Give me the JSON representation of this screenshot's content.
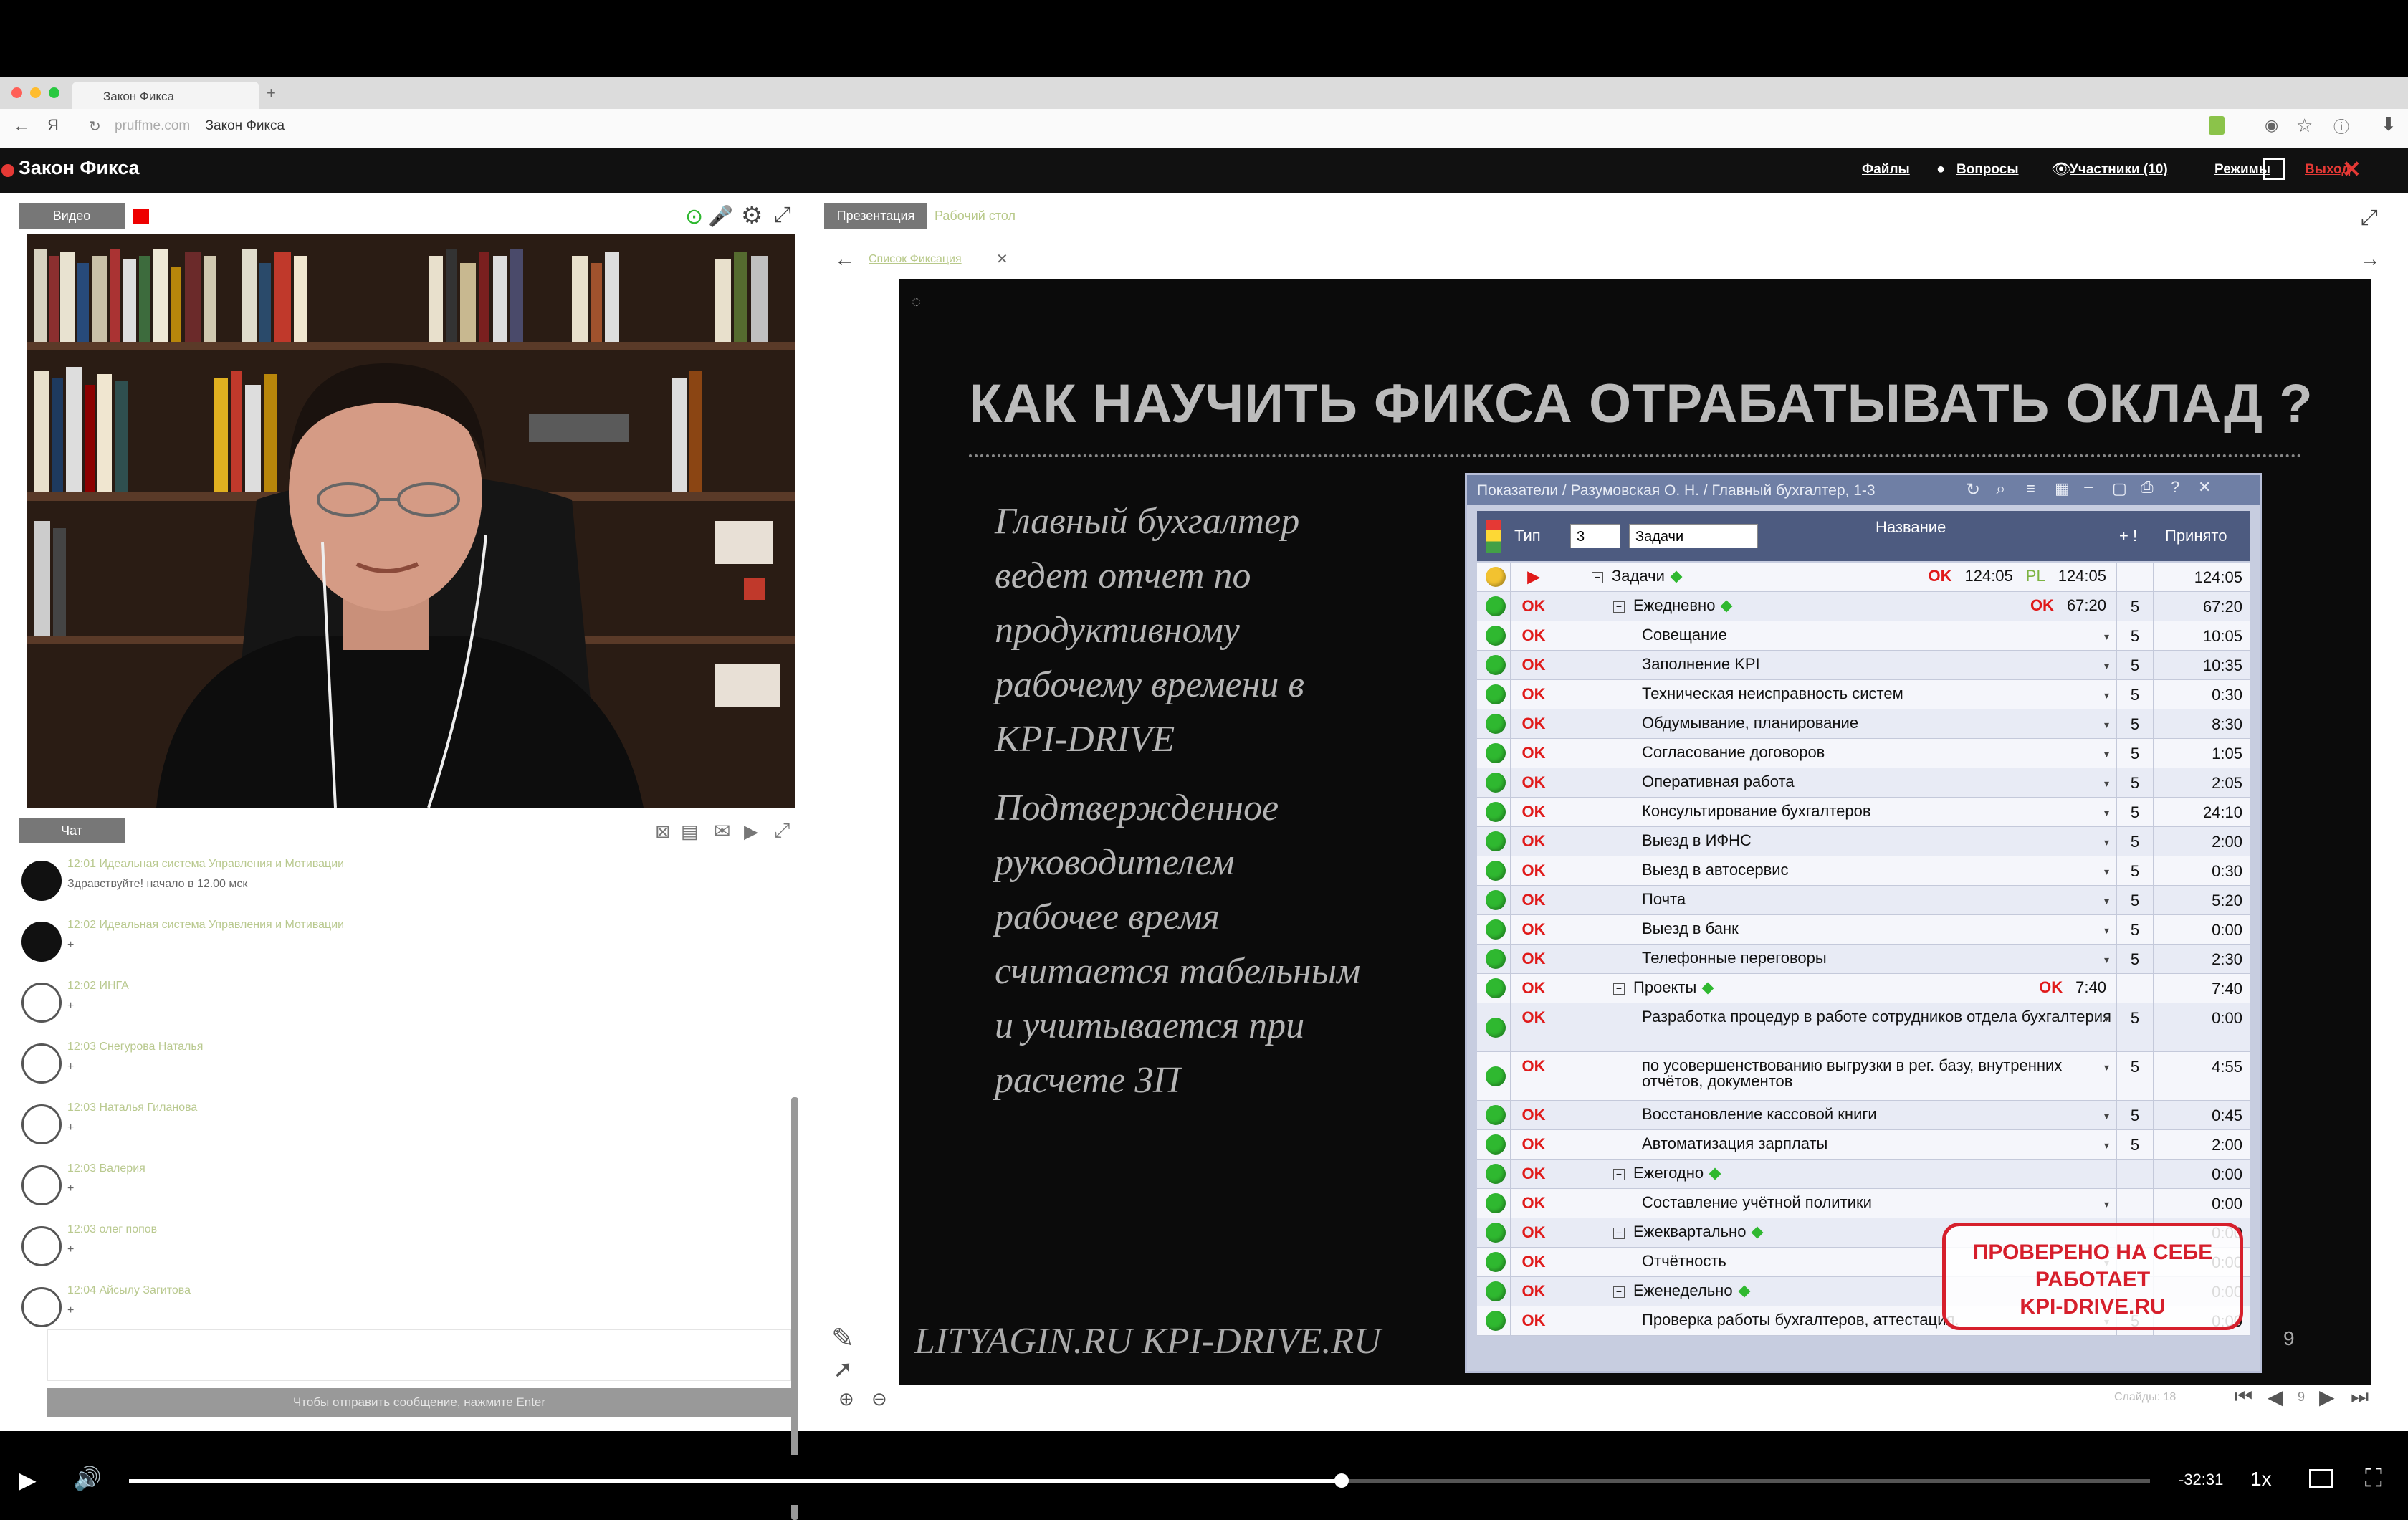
{
  "browser": {
    "tab_title": "Закон Фикса",
    "url_host": "pruffme.com",
    "url_page": "Закон Фикса"
  },
  "app": {
    "title": "Закон Фикса",
    "nav": {
      "files": "Файлы",
      "questions": "Вопросы",
      "participants": "Участники (10)",
      "modes": "Режимы",
      "exit": "Выход"
    }
  },
  "video_panel": {
    "tab_label": "Видео"
  },
  "chat": {
    "tab_label": "Чат",
    "messages": [
      {
        "meta": "12:01 Идеальная система Управления и Мотивации",
        "text": "Здравствуйте! начало в 12.00 мск"
      },
      {
        "meta": "12:02 Идеальная система Управления и Мотивации",
        "text": "+"
      },
      {
        "meta": "12:02 ИНГА",
        "text": "+"
      },
      {
        "meta": "12:03 Снегурова Наталья",
        "text": "+"
      },
      {
        "meta": "12:03 Наталья Гиланова",
        "text": "+"
      },
      {
        "meta": "12:03 Валерия",
        "text": "+"
      },
      {
        "meta": "12:03 олег попов",
        "text": "+"
      },
      {
        "meta": "12:04 Айсылу Загитова",
        "text": "+"
      }
    ],
    "send_hint": "Чтобы отправить сообщение, нажмите Enter"
  },
  "presentation": {
    "tab_presentation": "Презентация",
    "tab_desktop": "Рабочий стол",
    "file_tab": "Список Фиксация"
  },
  "slide": {
    "title": "КАК НАУЧИТЬ ФИКСА ОТРАБАТЫВАТЬ ОКЛАД ?",
    "paragraph1": "Главный бухгалтер ведет отчет по продуктивному рабочему времени в KPI-DRIVE",
    "paragraph2": "Подтвержденное руководителем рабочее время считается табельным и учитывается при расчете ЗП",
    "footer": "LITYAGIN.RU  KPI-DRIVE.RU",
    "page_number": "9",
    "stamp": [
      "ПРОВЕРЕНО НА СЕБЕ",
      "РАБОТАЕТ",
      "KPI-DRIVE.RU"
    ]
  },
  "kpi": {
    "window_title": "Показатели / Разумовская О. Н. / Главный бухгалтер, 1-3",
    "headers": {
      "type": "Тип",
      "period": "3",
      "filter": "Задачи",
      "name": "Название",
      "accepted": "Принято"
    },
    "rows": [
      {
        "type": "▶",
        "name": "Задачи",
        "level": 0,
        "group": true,
        "ok1": "OK",
        "v1": "124:05",
        "pl": "PL",
        "v2": "124:05",
        "five": "",
        "acc": "124:05",
        "light": "yellow"
      },
      {
        "type": "OK",
        "name": "Ежедневно",
        "level": 1,
        "group": true,
        "ok1": "OK",
        "v1": "67:20",
        "five": "5",
        "acc": "67:20"
      },
      {
        "type": "OK",
        "name": "Совещание",
        "level": 2,
        "five": "5",
        "acc": "10:05"
      },
      {
        "type": "OK",
        "name": "Заполнение KPI",
        "level": 2,
        "five": "5",
        "acc": "10:35"
      },
      {
        "type": "OK",
        "name": "Техническая неисправность систем",
        "level": 2,
        "five": "5",
        "acc": "0:30"
      },
      {
        "type": "OK",
        "name": "Обдумывание, планирование",
        "level": 2,
        "five": "5",
        "acc": "8:30"
      },
      {
        "type": "OK",
        "name": "Согласование договоров",
        "level": 2,
        "five": "5",
        "acc": "1:05"
      },
      {
        "type": "OK",
        "name": "Оперативная работа",
        "level": 2,
        "five": "5",
        "acc": "2:05"
      },
      {
        "type": "OK",
        "name": "Консультирование бухгалтеров",
        "level": 2,
        "five": "5",
        "acc": "24:10"
      },
      {
        "type": "OK",
        "name": "Выезд в ИФНС",
        "level": 2,
        "five": "5",
        "acc": "2:00"
      },
      {
        "type": "OK",
        "name": "Выезд в автосервис",
        "level": 2,
        "five": "5",
        "acc": "0:30"
      },
      {
        "type": "OK",
        "name": "Почта",
        "level": 2,
        "five": "5",
        "acc": "5:20"
      },
      {
        "type": "OK",
        "name": "Выезд в банк",
        "level": 2,
        "five": "5",
        "acc": "0:00"
      },
      {
        "type": "OK",
        "name": "Телефонные переговоры",
        "level": 2,
        "five": "5",
        "acc": "2:30"
      },
      {
        "type": "OK",
        "name": "Проекты",
        "level": 1,
        "group": true,
        "ok1": "OK",
        "v1": "7:40",
        "five": "",
        "acc": "7:40"
      },
      {
        "type": "OK",
        "name": "Разработка процедур в работе сотрудников отдела бухгалтерия",
        "level": 2,
        "tall": true,
        "five": "5",
        "acc": "0:00"
      },
      {
        "type": "OK",
        "name": "по усовершенствованию выгрузки в рег. базу, внутренних отчётов, документов",
        "level": 2,
        "tall": true,
        "five": "5",
        "acc": "4:55"
      },
      {
        "type": "OK",
        "name": "Восстановление кассовой книги",
        "level": 2,
        "five": "5",
        "acc": "0:45"
      },
      {
        "type": "OK",
        "name": "Автоматизация зарплаты",
        "level": 2,
        "five": "5",
        "acc": "2:00"
      },
      {
        "type": "OK",
        "name": "Ежегодно",
        "level": 1,
        "group": true,
        "five": "",
        "acc": "0:00"
      },
      {
        "type": "OK",
        "name": "Составление учётной политики",
        "level": 2,
        "five": "",
        "acc": "0:00"
      },
      {
        "type": "OK",
        "name": "Ежеквартально",
        "level": 1,
        "group": true,
        "five": "",
        "acc": "0:00"
      },
      {
        "type": "OK",
        "name": "Отчётность",
        "level": 2,
        "five": "",
        "acc": "0:00"
      },
      {
        "type": "OK",
        "name": "Еженедельно",
        "level": 1,
        "group": true,
        "five": "",
        "acc": "0:00"
      },
      {
        "type": "OK",
        "name": "Проверка работы бухгалтеров, аттестация.",
        "level": 2,
        "five": "5",
        "acc": "0:00"
      }
    ]
  },
  "slide_nav": {
    "slides_label": "Слайды: 18",
    "current": "9"
  },
  "player": {
    "time_remaining": "-32:31",
    "speed": "1x",
    "progress": 0.6
  },
  "colors": {
    "ok_red": "#e01a1a",
    "light_green": "#2fb830",
    "stamp_red": "#d61f2c",
    "header_blue": "#4d5b80"
  }
}
